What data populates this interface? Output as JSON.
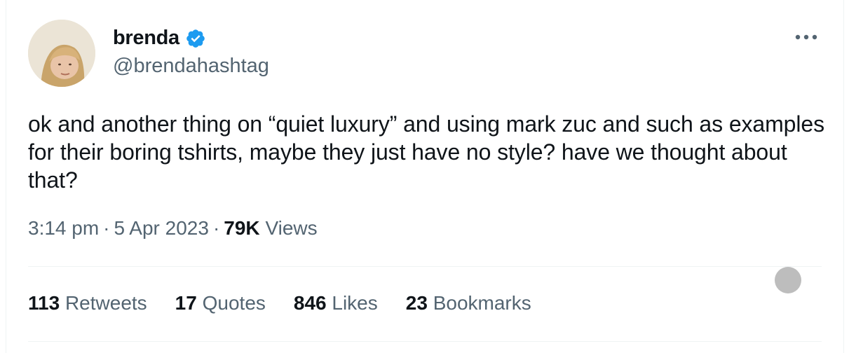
{
  "author": {
    "display_name": "brenda",
    "handle": "@brendahashtag",
    "verified": true,
    "badge_color": "#1d9bf0"
  },
  "tweet": {
    "text": "ok and another thing on “quiet luxury” and using mark zuc and such as examples for their boring tshirts, maybe they just have no style? have we thought about that?",
    "time": "3:14 pm",
    "date": "5 Apr 2023",
    "separator": "·",
    "views_count": "79K",
    "views_label": "Views"
  },
  "stats": [
    {
      "count": "113",
      "label": "Retweets"
    },
    {
      "count": "17",
      "label": "Quotes"
    },
    {
      "count": "846",
      "label": "Likes"
    },
    {
      "count": "23",
      "label": "Bookmarks"
    }
  ],
  "icons": {
    "more": "more-horizontal-icon",
    "verified": "verified-badge-icon"
  },
  "colors": {
    "text_primary": "#0f1419",
    "text_secondary": "#536471",
    "divider": "#eff3f4"
  }
}
